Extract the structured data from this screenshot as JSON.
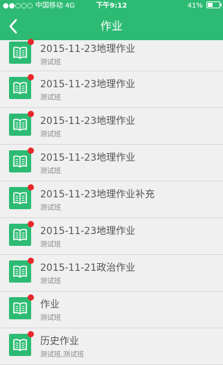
{
  "status_bar": {
    "carrier": "中国移动",
    "network": "4G",
    "time": "下午9:12",
    "battery_percent": "41%"
  },
  "nav": {
    "title": "作业",
    "back_icon": "chevron-left-icon"
  },
  "colors": {
    "header": "#2dbb73",
    "icon_bg": "#2dbb73",
    "badge": "#e8262b"
  },
  "items": [
    {
      "title": "2015-11-23地理作业",
      "class": "测试班"
    },
    {
      "title": "2015-11-23地理作业",
      "class": "测试班"
    },
    {
      "title": "2015-11-23地理作业",
      "class": "测试班"
    },
    {
      "title": "2015-11-23地理作业",
      "class": "测试班"
    },
    {
      "title": "2015-11-23地理作业补充",
      "class": "测试班"
    },
    {
      "title": "2015-11-23地理作业",
      "class": "测试班"
    },
    {
      "title": "2015-11-21政治作业",
      "class": "测试班"
    },
    {
      "title": "作业",
      "class": "测试班"
    },
    {
      "title": "历史作业",
      "class": "测试班,测试班"
    }
  ]
}
